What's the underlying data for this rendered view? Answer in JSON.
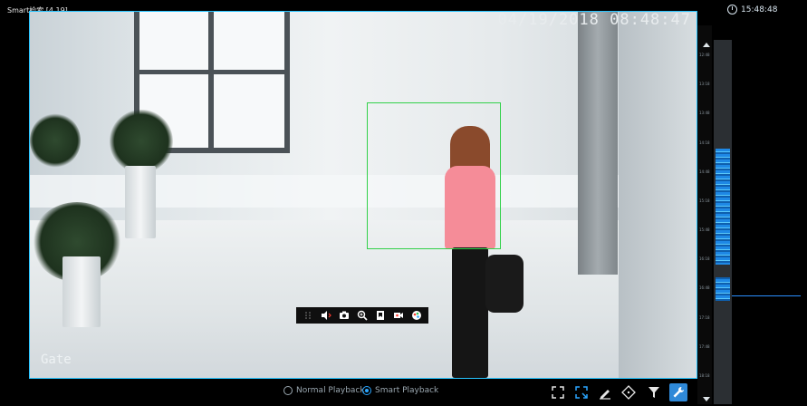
{
  "header": {
    "title": "Smart检索 [4.19]"
  },
  "clock": {
    "time": "15:48:48"
  },
  "video": {
    "timestamp": "04/19/2018 08:48:47",
    "camera_name": "Gate"
  },
  "camera_toolbar": {
    "icons": [
      "drag-handle-icon",
      "audio-icon",
      "snapshot-icon",
      "zoom-icon",
      "bookmark-icon",
      "record-icon",
      "color-icon"
    ]
  },
  "timeline": {
    "labels": [
      "12:48",
      "13:18",
      "13:48",
      "14:18",
      "14:48",
      "15:18",
      "15:48",
      "16:18",
      "16:48",
      "17:18",
      "17:48",
      "18:18"
    ]
  },
  "playback": {
    "normal_label": "Normal Playback",
    "smart_label": "Smart Playback",
    "selected": "smart"
  },
  "controls": {
    "icons": [
      "fullscreen-icon",
      "region-select-icon",
      "draw-line-icon",
      "motion-target-icon",
      "filter-icon",
      "settings-wrench-icon"
    ]
  },
  "colors": {
    "accent": "#2aa6ff",
    "detection": "#32d14a",
    "timeline_hit": "#1e88e5"
  }
}
